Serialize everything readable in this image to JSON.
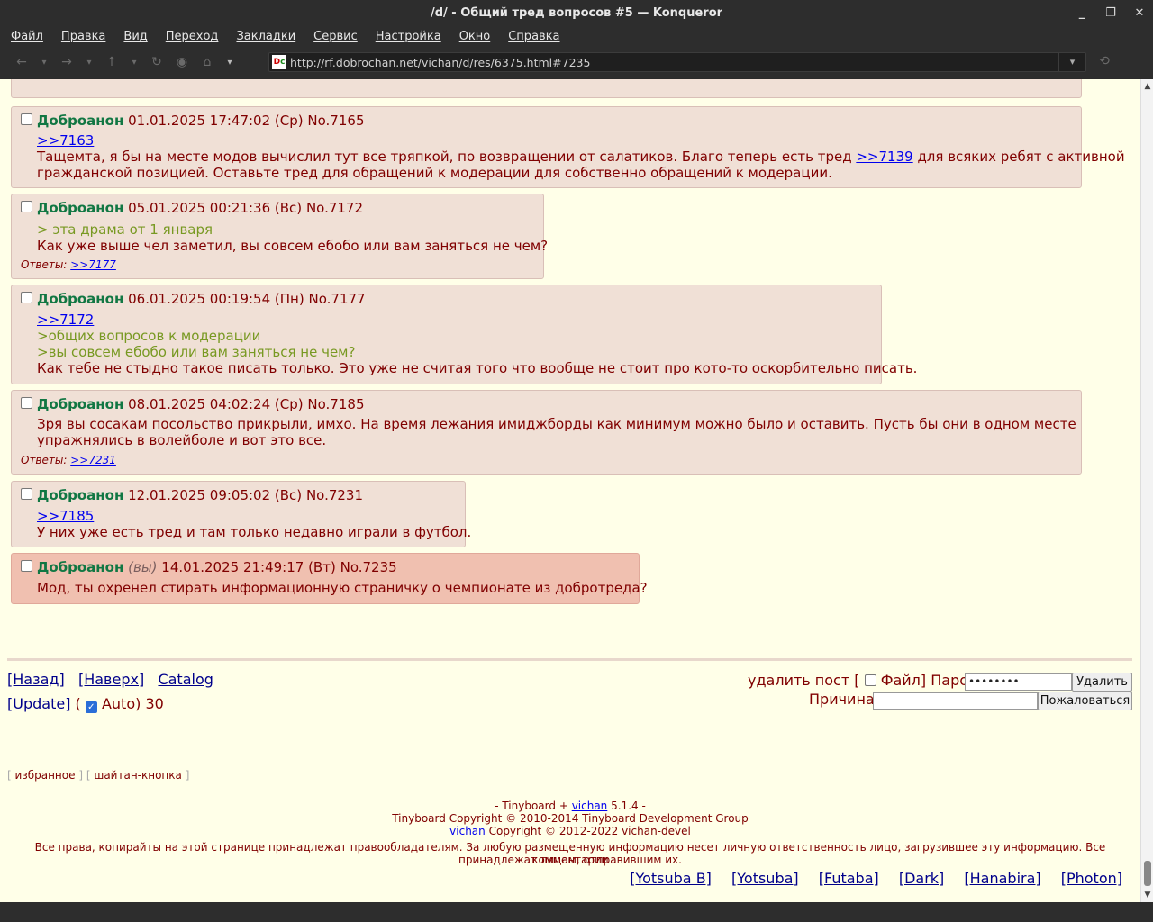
{
  "window": {
    "title": "/d/ - Общий тред вопросов #5 — Konqueror",
    "controls": [
      "_",
      "❐",
      "✕"
    ]
  },
  "menu": [
    "Файл",
    "Правка",
    "Вид",
    "Переход",
    "Закладки",
    "Сервис",
    "Настройка",
    "Окно",
    "Справка"
  ],
  "toolbar": {
    "url": "http://rf.dobrochan.net/vichan/d/res/6375.html#7235",
    "icons": [
      "back-icon",
      "forward-icon",
      "up-icon",
      "reload-icon",
      "stop-icon",
      "home-icon"
    ]
  },
  "posts": [
    {
      "name": "Доброанон",
      "you": "",
      "date": "01.01.2025 17:47:02 (Ср)",
      "no": "No.7165",
      "lines": [
        {
          "type": "link",
          "text": ">>7163"
        },
        {
          "type": "mixed",
          "before": "Тащемта, я бы на месте модов вычислил тут все тряпкой, по возвращении от салатиков. Благо теперь есть тред ",
          "link": ">>7139",
          "after": " для всяких ребят с активной"
        },
        {
          "type": "text",
          "text": "гражданской позицией. Оставьте тред для обращений к модерации для собственно обращений к модерации."
        }
      ],
      "replies": ""
    },
    {
      "name": "Доброанон",
      "you": "",
      "date": "05.01.2025 00:21:36 (Вс)",
      "no": "No.7172",
      "lines": [
        {
          "type": "quote",
          "text": "> эта драма от 1 января"
        },
        {
          "type": "text",
          "text": "Как уже выше чел заметил, вы совсем ебобо или вам заняться не чем?"
        }
      ],
      "replies_label": "Ответы:",
      "replies": ">>7177"
    },
    {
      "name": "Доброанон",
      "you": "",
      "date": "06.01.2025 00:19:54 (Пн)",
      "no": "No.7177",
      "lines": [
        {
          "type": "link",
          "text": ">>7172"
        },
        {
          "type": "quote",
          "text": ">общих вопросов к модерации"
        },
        {
          "type": "quote",
          "text": ">вы совсем ебобо или вам заняться не чем?"
        },
        {
          "type": "text",
          "text": "Как тебе не стыдно такое писать только. Это уже не считая того что вообще не стоит про кото-то оскорбительно писать."
        }
      ],
      "replies": ""
    },
    {
      "name": "Доброанон",
      "you": "",
      "date": "08.01.2025 04:02:24 (Ср)",
      "no": "No.7185",
      "lines": [
        {
          "type": "text",
          "text": "Зря вы сосакам посольство прикрыли, имхо. На время лежания имиджборды как минимум можно было и оставить. Пусть бы они в одном месте"
        },
        {
          "type": "text",
          "text": "упражнялись в волейболе и вот это все."
        }
      ],
      "replies_label": "Ответы:",
      "replies": ">>7231"
    },
    {
      "name": "Доброанон",
      "you": "",
      "date": "12.01.2025 09:05:02 (Вс)",
      "no": "No.7231",
      "lines": [
        {
          "type": "link",
          "text": ">>7185"
        },
        {
          "type": "text",
          "text": "У них уже есть тред и там только недавно играли в футбол."
        }
      ],
      "replies": ""
    },
    {
      "name": "Доброанон",
      "you": "(вы)",
      "date": "14.01.2025 21:49:17 (Вт)",
      "no": "No.7235",
      "lines": [
        {
          "type": "text",
          "text": "Мод, ты охренел стирать информационную страничку о чемпионате из добротреда?"
        }
      ],
      "replies": ""
    }
  ],
  "nav": {
    "back": "[Назад]",
    "top": "[Наверх]",
    "catalog": "Catalog",
    "update": "[Update]",
    "auto_open": "(",
    "auto_label": "Auto)",
    "auto_seconds": "30"
  },
  "delete_form": {
    "label": "удалить пост [",
    "file_label": "Файл]",
    "password_label": "Пароль",
    "password_value": "••••••••",
    "delete_button": "Удалить",
    "reason_label": "Причина",
    "reason_value": "",
    "report_button": "Пожаловаться"
  },
  "bottom_links": {
    "favorites": "избранное",
    "shaitan": "шайтан-кнопка"
  },
  "footer": {
    "line1_before": "- Tinyboard + ",
    "line1_link": "vichan",
    "line1_after": " 5.1.4 -",
    "line2": "Tinyboard Copyright © 2010-2014 Tinyboard Development Group",
    "line3_link": "vichan",
    "line3_after": " Copyright © 2012-2022 vichan-devel",
    "line4": "Все права, копирайты на этой странице принадлежат правообладателям. За любую размещенную информацию несет личную ответственность лицо, загрузившее эту информацию. Все комментарии",
    "line5": "принадлежат лицам, отправившим их."
  },
  "styles": [
    "[Yotsuba B]",
    "[Yotsuba]",
    "[Futaba]",
    "[Dark]",
    "[Hanabira]",
    "[Photon]"
  ],
  "colors": {
    "post_bg": "#f0e0d6",
    "my_post_bg": "#f0c0b0",
    "page_bg": "#ffffe8",
    "name": "#117743",
    "quote": "#789922",
    "text": "#800000"
  }
}
